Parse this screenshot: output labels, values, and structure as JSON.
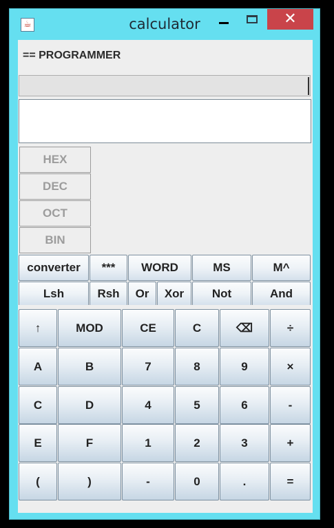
{
  "window": {
    "title": "calculator",
    "icon": "java-icon",
    "controls": {
      "minimize": "minimize-icon",
      "maximize": "maximize-icon",
      "close": "✕"
    }
  },
  "mode_label": "== PROGRAMMER",
  "expression": "",
  "display": "",
  "bases": [
    "HEX",
    "DEC",
    "OCT",
    "BIN"
  ],
  "row1": [
    "converter",
    "***",
    "WORD",
    "MS",
    "M^"
  ],
  "row2": [
    "Lsh",
    "Rsh",
    "Or",
    "Xor",
    "Not",
    "And"
  ],
  "keypad": [
    [
      "↑",
      "MOD",
      "CE",
      "C",
      "⌫",
      "÷"
    ],
    [
      "A",
      "B",
      "7",
      "8",
      "9",
      "×"
    ],
    [
      "C",
      "D",
      "4",
      "5",
      "6",
      "-"
    ],
    [
      "E",
      "F",
      "1",
      "2",
      "3",
      "+"
    ],
    [
      "(",
      ")",
      "-",
      "0",
      ".",
      "="
    ]
  ]
}
